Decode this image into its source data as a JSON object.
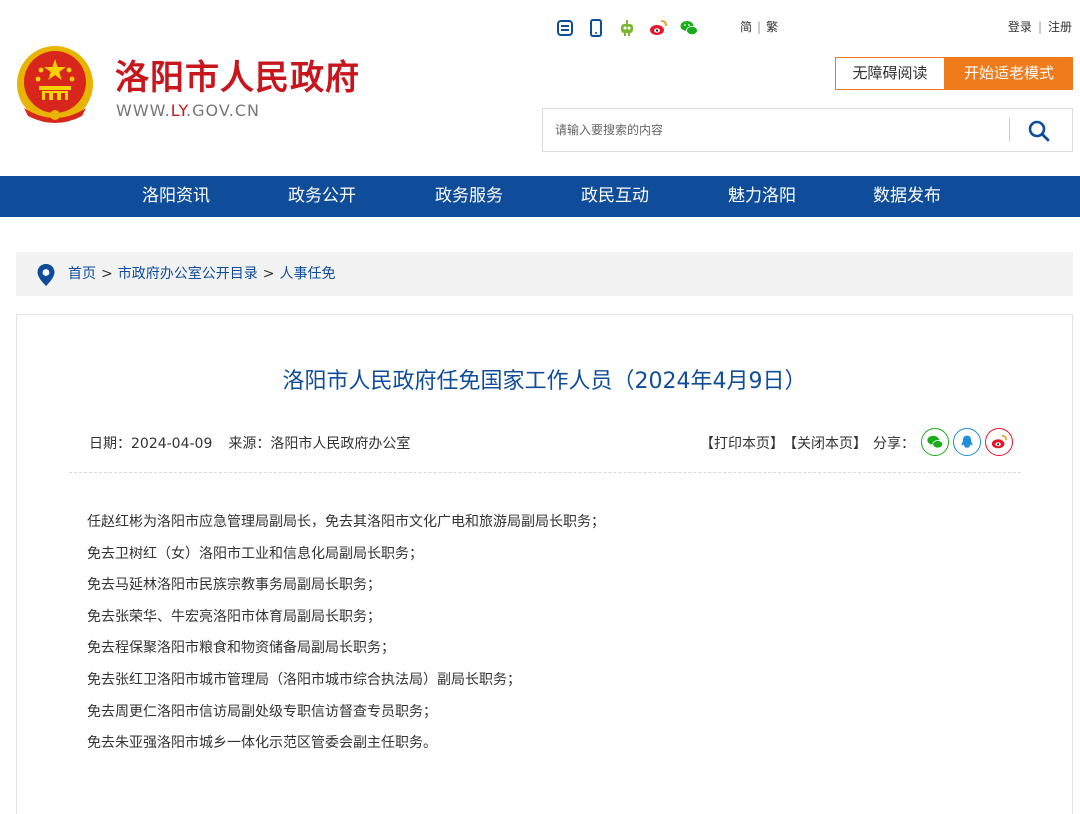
{
  "site": {
    "title": "洛阳市人民政府",
    "url_prefix": "WWW.",
    "url_highlight": "LY",
    "url_suffix": ".GOV.CN",
    "brand_color": "#c8161d"
  },
  "top_icons": [
    "app-icon",
    "mobile-icon",
    "robot-icon",
    "weibo-icon",
    "wechat-icon"
  ],
  "lang": {
    "simplified": "简",
    "traditional": "繁"
  },
  "auth": {
    "login": "登录",
    "register": "注册"
  },
  "accessibility": {
    "reader_label": "无障碍阅读",
    "elder_label": "开始适老模式",
    "accent": "#f07b1d"
  },
  "search": {
    "placeholder": "请输入要搜索的内容"
  },
  "nav": {
    "color": "#0f4d9a",
    "items": [
      "洛阳资讯",
      "政务公开",
      "政务服务",
      "政民互动",
      "魅力洛阳",
      "数据发布"
    ]
  },
  "breadcrumb": {
    "home": "首页",
    "section": "市政府办公室公开目录",
    "current": "人事任免",
    "sep": ">"
  },
  "article": {
    "title": "洛阳市人民政府任免国家工作人员（2024年4月9日）",
    "date_label": "日期：2024-04-09",
    "source_label": "来源：洛阳市人民政府办公室",
    "print": "【打印本页】",
    "close": "【关闭本页】",
    "share": "分享：",
    "share_icons": [
      "wechat-icon",
      "qq-icon",
      "weibo-icon"
    ],
    "lines": [
      "任赵红彬为洛阳市应急管理局副局长，免去其洛阳市文化广电和旅游局副局长职务；",
      "免去卫树红（女）洛阳市工业和信息化局副局长职务；",
      "免去马延林洛阳市民族宗教事务局副局长职务；",
      "免去张荣华、牛宏亮洛阳市体育局副局长职务；",
      "免去程保聚洛阳市粮食和物资储备局副局长职务；",
      "免去张红卫洛阳市城市管理局（洛阳市城市综合执法局）副局长职务；",
      "免去周更仁洛阳市信访局副处级专职信访督查专员职务；",
      "免去朱亚强洛阳市城乡一体化示范区管委会副主任职务。"
    ]
  }
}
